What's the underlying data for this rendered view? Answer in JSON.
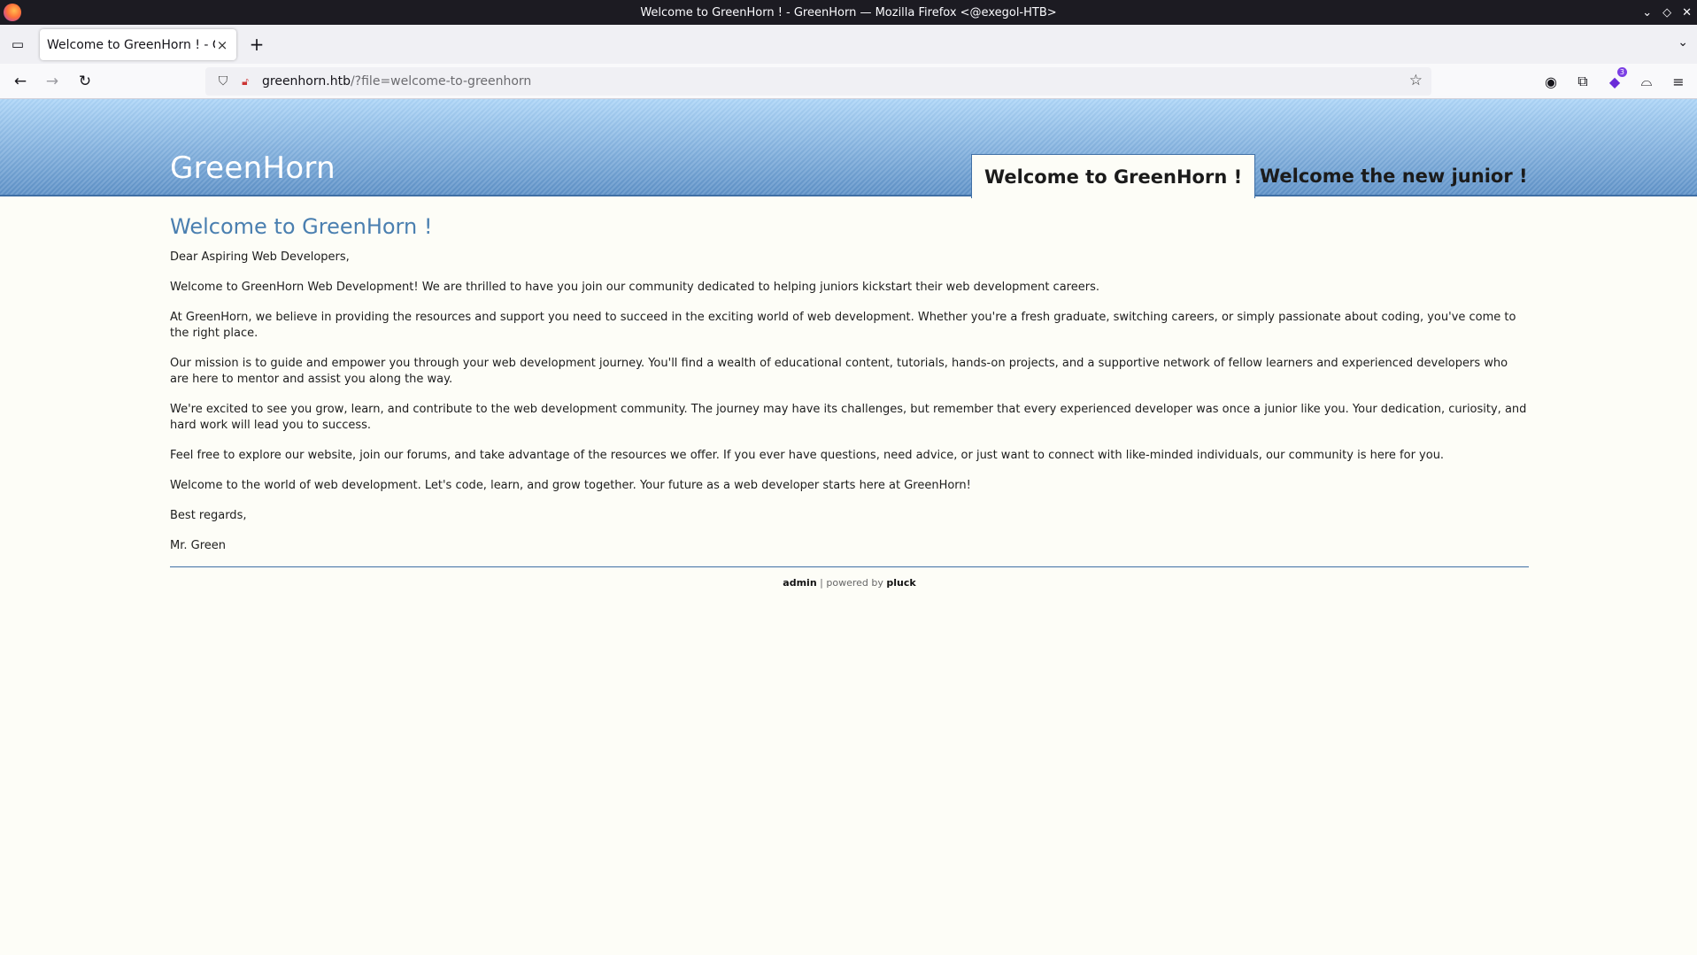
{
  "window": {
    "title": "Welcome to GreenHorn ! - GreenHorn — Mozilla Firefox <@exegol-HTB>"
  },
  "tabs": [
    {
      "title": "Welcome to GreenHorn ! - G"
    }
  ],
  "urlbar": {
    "host": "greenhorn.htb",
    "path": "/?file=welcome-to-greenhorn"
  },
  "toolbar": {
    "extension_badge": "3"
  },
  "site": {
    "title": "GreenHorn",
    "nav": [
      {
        "label": "Welcome to GreenHorn !",
        "active": true
      },
      {
        "label": "Welcome the new junior !",
        "active": false
      }
    ],
    "heading": "Welcome to GreenHorn !",
    "paragraphs": [
      "Dear Aspiring Web Developers,",
      "Welcome to GreenHorn Web Development! We are thrilled to have you join our community dedicated to helping juniors kickstart their web development careers.",
      "At GreenHorn, we believe in providing the resources and support you need to succeed in the exciting world of web development. Whether you're a fresh graduate, switching careers, or simply passionate about coding, you've come to the right place.",
      "Our mission is to guide and empower you through your web development journey. You'll find a wealth of educational content, tutorials, hands-on projects, and a supportive network of fellow learners and experienced developers who are here to mentor and assist you along the way.",
      "We're excited to see you grow, learn, and contribute to the web development community. The journey may have its challenges, but remember that every experienced developer was once a junior like you. Your dedication, curiosity, and hard work will lead you to success.",
      "Feel free to explore our website, join our forums, and take advantage of the resources we offer. If you ever have questions, need advice, or just want to connect with like-minded individuals, our community is here for you.",
      "Welcome to the world of web development. Let's code, learn, and grow together. Your future as a web developer starts here at GreenHorn!",
      "Best regards,",
      "Mr. Green"
    ],
    "footer": {
      "admin_link": "admin",
      "separator": " | powered by ",
      "pluck_link": "pluck"
    }
  },
  "colors": {
    "header_top": "#aed6f8",
    "header_bottom": "#5f92c8",
    "heading_blue": "#4a7fb0",
    "page_bg": "#fdfdf7"
  }
}
